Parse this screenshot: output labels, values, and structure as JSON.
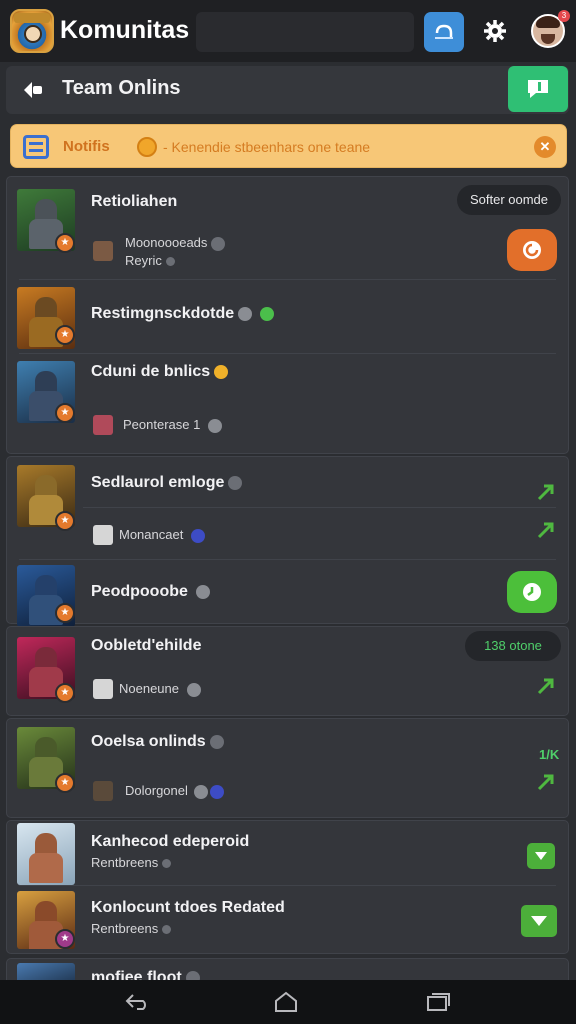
{
  "app": {
    "title": "Komunitas",
    "notification_count": "3"
  },
  "header": {
    "title": "Team Onlins"
  },
  "notice": {
    "label": "Notifis",
    "text": "- Kenendie stbeenhars one teane"
  },
  "cards": [
    {
      "rows": [
        {
          "name": "Retioliahen",
          "status_pill": "Softer oomde",
          "mini_label": "Moonoooeads",
          "mini_label2": "Reyric",
          "action": "chat-orange"
        },
        {
          "name": "Restimgnsckdotde"
        },
        {
          "name": "Cduni de bnlics",
          "mini_label": "Peonterase 1"
        }
      ]
    },
    {
      "rows": [
        {
          "name": "Sedlaurol emloge",
          "mini_label": "Monancaet"
        },
        {
          "name": "Peodpooobe",
          "action": "chat-green"
        }
      ]
    },
    {
      "rows": [
        {
          "name": "Oobletd'ehilde",
          "status_pill": "138 otone",
          "mini_label": "Noeneune"
        }
      ]
    },
    {
      "rows": [
        {
          "name": "Ooelsa onlinds",
          "mini_label": "Dolorgonel",
          "count": "1/K"
        }
      ]
    },
    {
      "rows": [
        {
          "name": "Kanhecod edeperoid",
          "mini_label": "Rentbreens"
        },
        {
          "name": "Konlocunt tdoes Redated",
          "mini_label": "Rentbreens"
        }
      ]
    },
    {
      "rows": [
        {
          "name": "mofiee floot"
        }
      ]
    }
  ],
  "colors": {
    "background": "#2b2d31",
    "accent_green": "#2fbf74",
    "accent_blue": "#3e8ed8",
    "notice_bg": "#f7c777",
    "accent_orange": "#e47a2d"
  },
  "icons": [
    "app-logo",
    "cloud-icon",
    "gear-icon",
    "back-icon",
    "chat-icon",
    "list-icon",
    "close-icon",
    "arrow-icon",
    "check-icon",
    "nav-back-icon",
    "nav-home-icon",
    "nav-recents-icon"
  ]
}
